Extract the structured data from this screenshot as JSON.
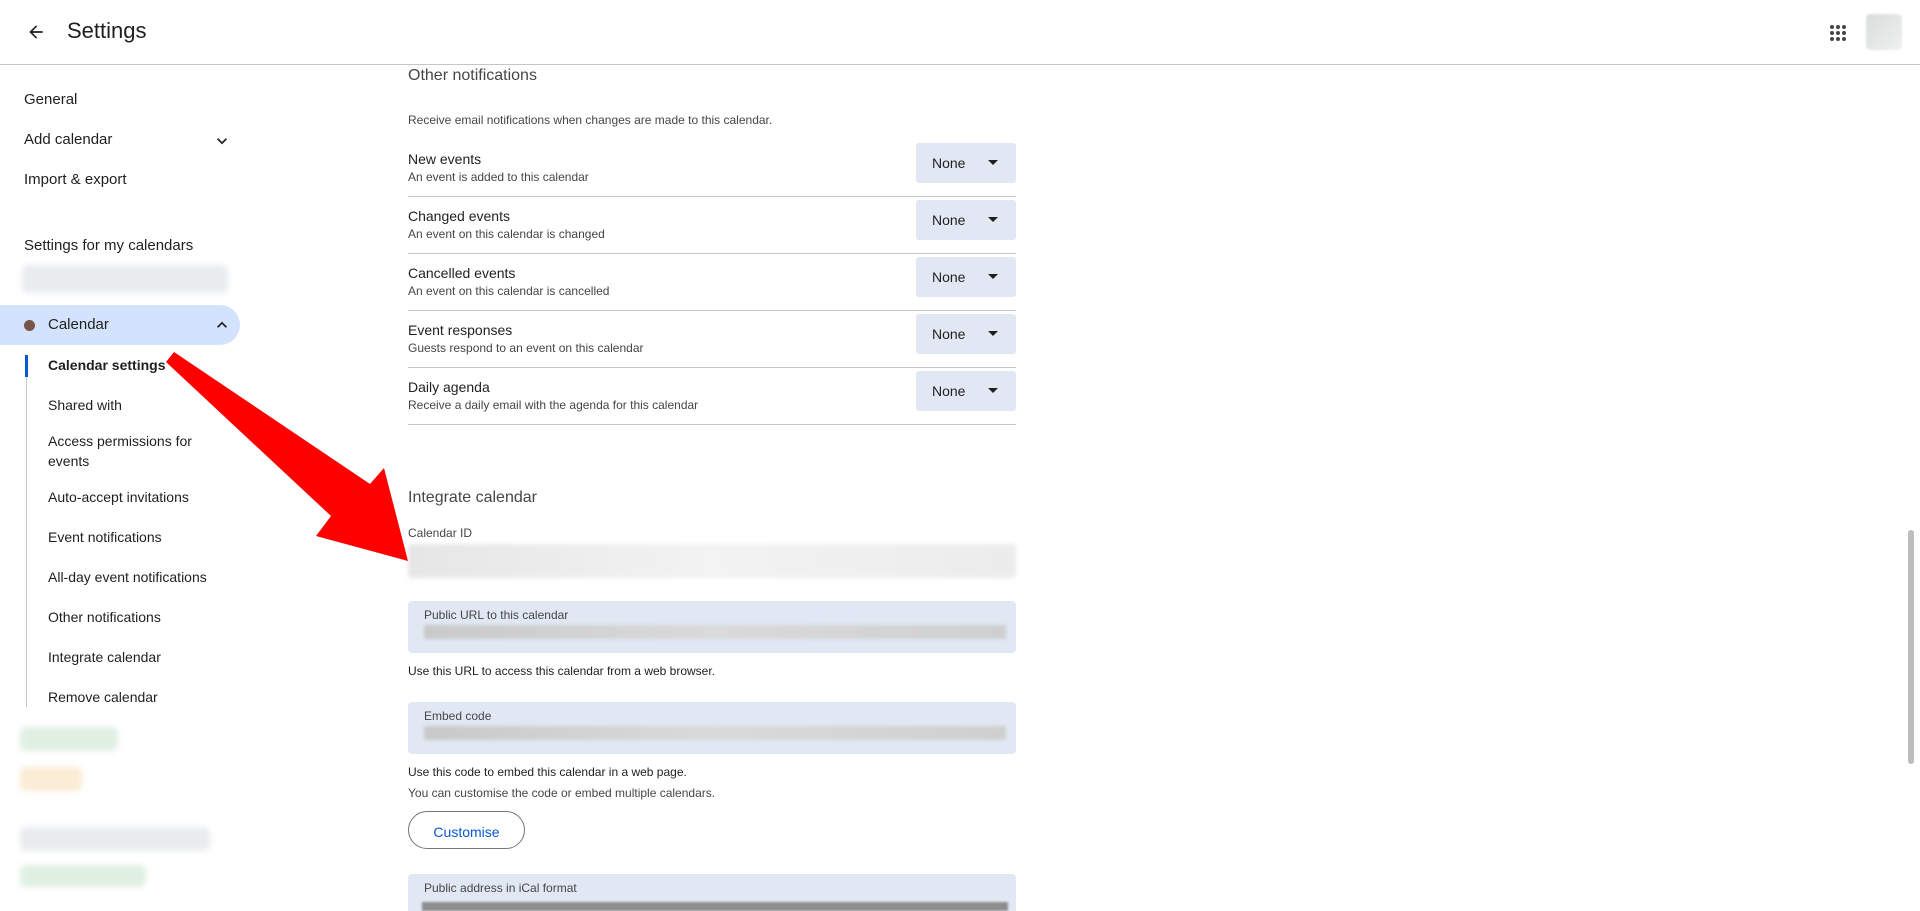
{
  "header": {
    "title": "Settings"
  },
  "sidebar": {
    "general": "General",
    "add_calendar": "Add calendar",
    "import_export": "Import & export",
    "my_calendars_heading": "Settings for my calendars",
    "calendar": {
      "name": "Calendar",
      "color": "#795548"
    },
    "sub_items": [
      "Calendar settings",
      "Shared with",
      "Access permissions for events",
      "Auto-accept invitations",
      "Event notifications",
      "All-day event notifications",
      "Other notifications",
      "Integrate calendar",
      "Remove calendar"
    ]
  },
  "other_notifications": {
    "heading": "Other notifications",
    "description": "Receive email notifications when changes are made to this calendar.",
    "rows": [
      {
        "title": "New events",
        "subtitle": "An event is added to this calendar",
        "value": "None"
      },
      {
        "title": "Changed events",
        "subtitle": "An event on this calendar is changed",
        "value": "None"
      },
      {
        "title": "Cancelled events",
        "subtitle": "An event on this calendar is cancelled",
        "value": "None"
      },
      {
        "title": "Event responses",
        "subtitle": "Guests respond to an event on this calendar",
        "value": "None"
      },
      {
        "title": "Daily agenda",
        "subtitle": "Receive a daily email with the agenda for this calendar",
        "value": "None"
      }
    ]
  },
  "integrate": {
    "heading": "Integrate calendar",
    "calendar_id_label": "Calendar ID",
    "public_url_label": "Public URL to this calendar",
    "public_url_help": "Use this URL to access this calendar from a web browser.",
    "embed_label": "Embed code",
    "embed_help": "Use this code to embed this calendar in a web page.",
    "embed_help2": "You can customise the code or embed multiple calendars.",
    "customise_button": "Customise",
    "ical_label": "Public address in iCal format"
  },
  "colors": {
    "accent": "#0b57d0",
    "active_pill": "#d3e3fd",
    "select_bg": "#e1e8f3",
    "arrow": "#ff0000"
  }
}
